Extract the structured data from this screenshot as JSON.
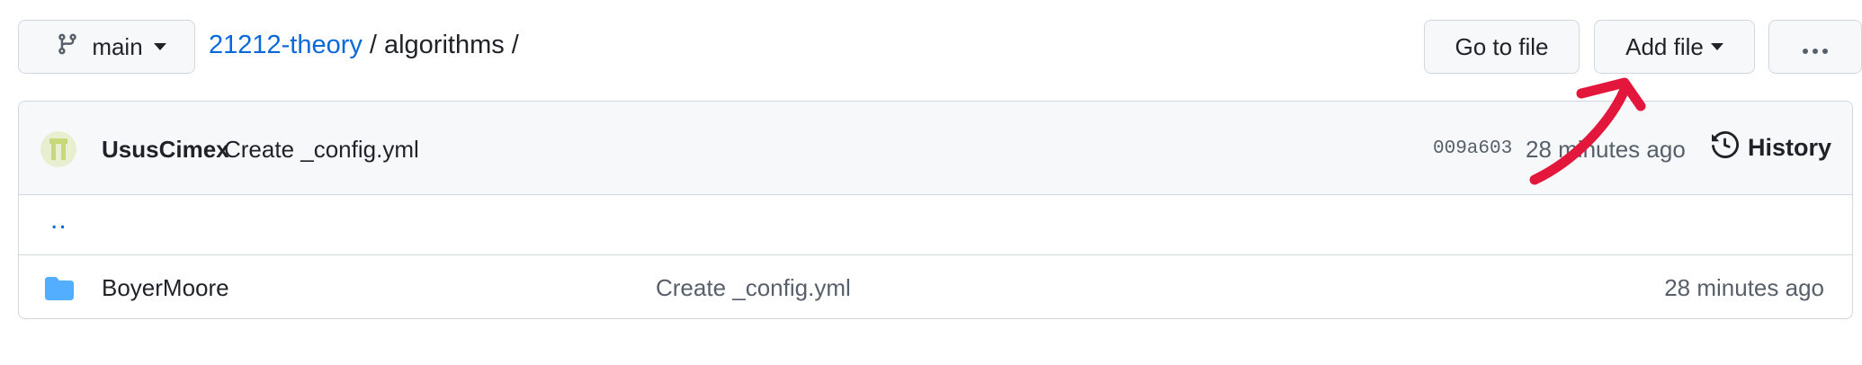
{
  "branch": {
    "name": "main"
  },
  "breadcrumb": {
    "repo": "21212-theory",
    "separator": "/",
    "folder": "algorithms",
    "trailing": "/"
  },
  "actions": {
    "goto_label": "Go to file",
    "addfile_label": "Add file"
  },
  "commit": {
    "author": "UsusCimex",
    "message": "Create _config.yml",
    "sha": "009a603",
    "time": "28 minutes ago",
    "history_label": "History"
  },
  "parent_dir": {
    "label": ".."
  },
  "files": [
    {
      "name": "BoyerMoore",
      "message": "Create _config.yml",
      "time": "28 minutes ago"
    }
  ],
  "icons": {
    "branch": "git-branch-icon",
    "kebab": "kebab-horizontal-icon",
    "history": "history-icon",
    "folder": "folder-icon"
  },
  "colors": {
    "link": "#0969da",
    "folder": "#54aeff",
    "annotation": "#e3173b"
  }
}
